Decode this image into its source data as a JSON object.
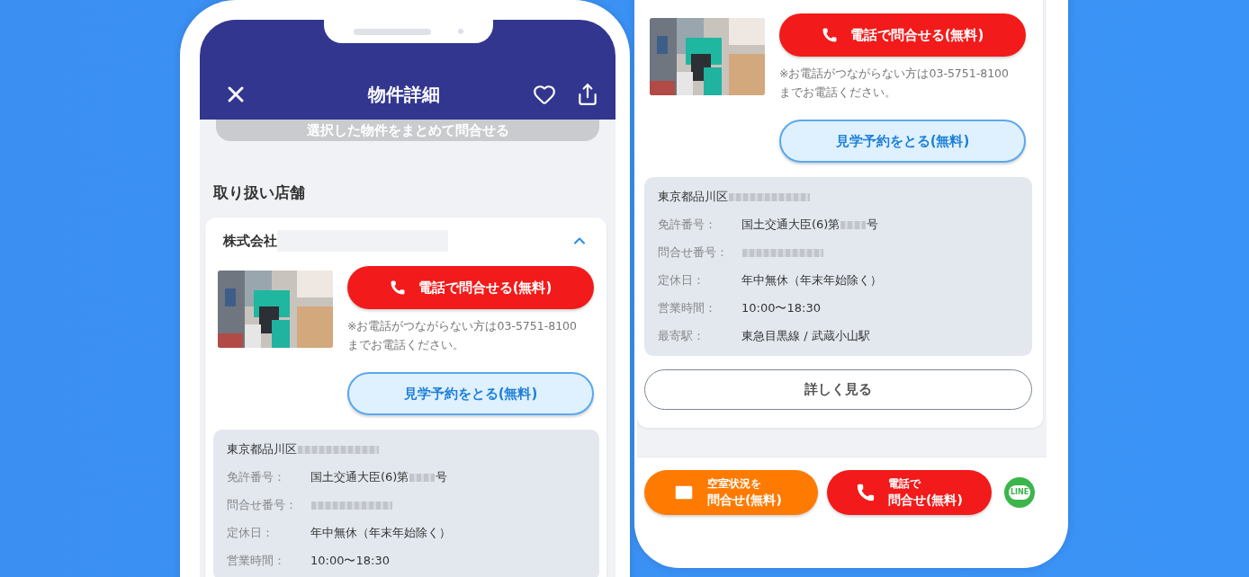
{
  "left_screen": {
    "header": {
      "title": "物件詳細"
    },
    "bulk_inquiry_button": "選択した物件をまとめて問合せる",
    "section_title": "取り扱い店舗",
    "shop": {
      "name": "株式会社",
      "name_redacted": true,
      "expanded": true,
      "call_button": "電話で問合せる(無料)",
      "note_lines": [
        "※お電話がつながらない方は03-5751-8100",
        "までお電話ください。"
      ],
      "visit_button": "見学予約をとる(無料)",
      "info": [
        {
          "kind": "address",
          "value": "東京都品川区",
          "redacted": true
        },
        {
          "kind": "field",
          "label": "免許番号：",
          "value": "国土交通大臣(6)第",
          "redacted": true,
          "suffix": "号"
        },
        {
          "kind": "field",
          "label": "問合せ番号：",
          "redacted": true
        },
        {
          "kind": "field",
          "label": "定休日：",
          "value": "年中無休（年末年始除く）",
          "redacted": false
        },
        {
          "kind": "field",
          "label": "営業時間：",
          "value": "10:00〜18:30",
          "redacted": false
        }
      ]
    }
  },
  "right_screen": {
    "shop": {
      "call_button": "電話で問合せる(無料)",
      "note_lines": [
        "※お電話がつながらない方は03-5751-8100",
        "までお電話ください。"
      ],
      "visit_button": "見学予約をとる(無料)",
      "info": [
        {
          "kind": "address",
          "value": "東京都品川区",
          "redacted": true
        },
        {
          "kind": "field",
          "label": "免許番号：",
          "value": "国土交通大臣(6)第",
          "redacted": true,
          "suffix": "号"
        },
        {
          "kind": "field",
          "label": "問合せ番号：",
          "redacted": true
        },
        {
          "kind": "field",
          "label": "定休日：",
          "value": "年中無休（年末年始除く）",
          "redacted": false
        },
        {
          "kind": "field",
          "label": "営業時間：",
          "value": "10:00〜18:30",
          "redacted": false
        },
        {
          "kind": "field",
          "label": "最寄駅：",
          "value": "東急目黒線 / 武蔵小山駅",
          "redacted": false
        }
      ]
    },
    "details_button": "詳しく見る",
    "bottom_bar": {
      "buttons": [
        {
          "kind": "mail",
          "color": "#ff7a00",
          "lines": [
            "空室状況を",
            "問合せ(無料)"
          ]
        },
        {
          "kind": "phone",
          "color": "#f21a1a",
          "lines": [
            "電話で",
            "問合せ(無料)"
          ]
        }
      ],
      "line_button": "LINE"
    }
  }
}
